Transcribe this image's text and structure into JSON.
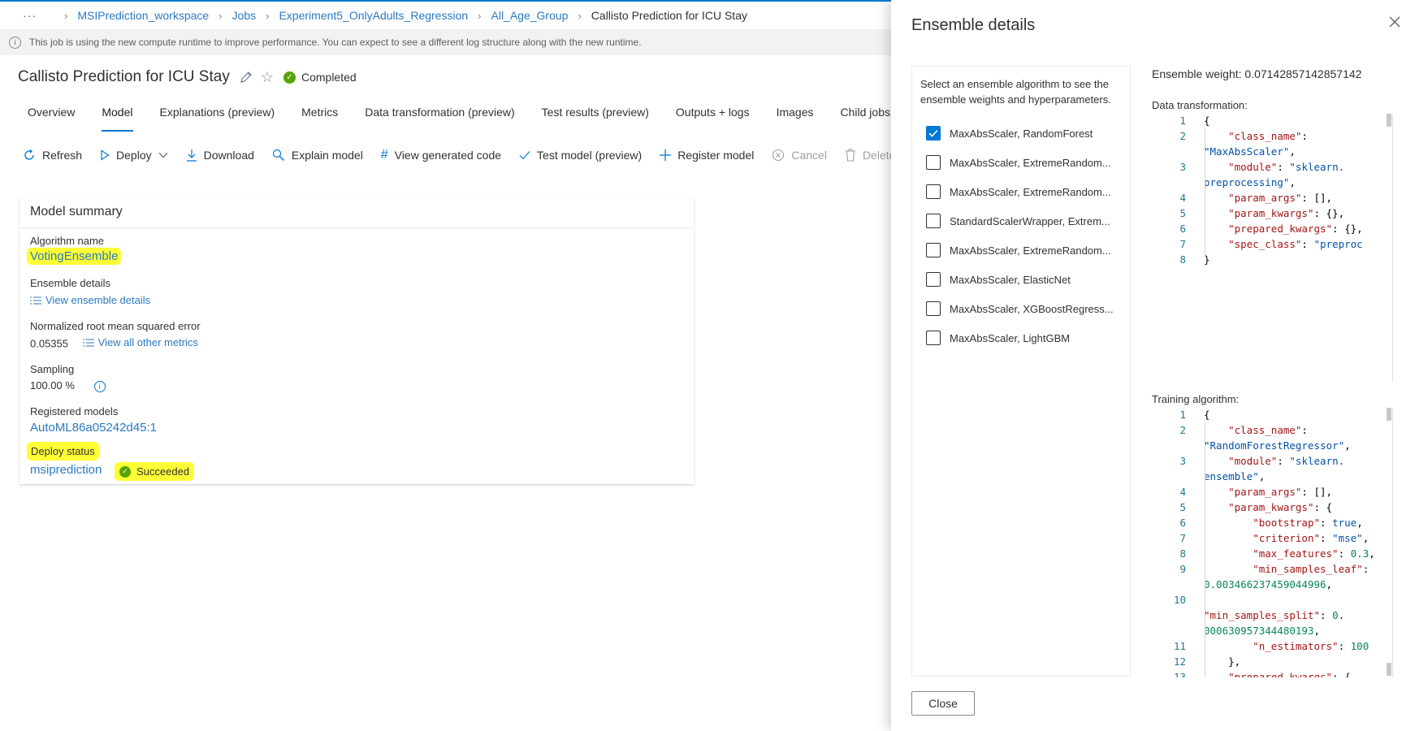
{
  "breadcrumb": {
    "more": "···",
    "items": [
      "MSIPrediction_workspace",
      "Jobs",
      "Experiment5_OnlyAdults_Regression",
      "All_Age_Group"
    ],
    "current": "Callisto Prediction for ICU Stay"
  },
  "info_bar": "This job is using the new compute runtime to improve performance. You can expect to see a different log structure along with the new runtime.",
  "job": {
    "title": "Callisto Prediction for ICU Stay",
    "status": "Completed"
  },
  "tabs": [
    "Overview",
    "Model",
    "Explanations (preview)",
    "Metrics",
    "Data transformation (preview)",
    "Test results (preview)",
    "Outputs + logs",
    "Images",
    "Child jobs"
  ],
  "active_tab": "Model",
  "toolbar": {
    "refresh": "Refresh",
    "deploy": "Deploy",
    "download": "Download",
    "explain": "Explain model",
    "view_code": "View generated code",
    "test_model": "Test model (preview)",
    "register": "Register model",
    "cancel": "Cancel",
    "delete": "Delete"
  },
  "summary": {
    "title": "Model summary",
    "algorithm_label": "Algorithm name",
    "algorithm_value": "VotingEnsemble",
    "ensemble_label": "Ensemble details",
    "ensemble_link": "View ensemble details",
    "nrmse_label": "Normalized root mean squared error",
    "nrmse_value": "0.05355",
    "metrics_link": "View all other metrics",
    "sampling_label": "Sampling",
    "sampling_value": "100.00 %",
    "registered_label": "Registered models",
    "registered_value": "AutoML86a05242d45:1",
    "deploy_label": "Deploy status",
    "deploy_value": "msiprediction",
    "deploy_status": "Succeeded"
  },
  "panel": {
    "title": "Ensemble details",
    "prompt": "Select an ensemble algorithm to see the ensemble weights and hyperparameters.",
    "algorithms": [
      {
        "label": "MaxAbsScaler, RandomForest",
        "checked": true
      },
      {
        "label": "MaxAbsScaler, ExtremeRandom...",
        "checked": false
      },
      {
        "label": "MaxAbsScaler, ExtremeRandom...",
        "checked": false
      },
      {
        "label": "StandardScalerWrapper, Extrem...",
        "checked": false
      },
      {
        "label": "MaxAbsScaler, ExtremeRandom...",
        "checked": false
      },
      {
        "label": "MaxAbsScaler, ElasticNet",
        "checked": false
      },
      {
        "label": "MaxAbsScaler, XGBoostRegress...",
        "checked": false
      },
      {
        "label": "MaxAbsScaler, LightGBM",
        "checked": false
      }
    ],
    "weight": "Ensemble weight: 0.07142857142857142",
    "data_transformation_label": "Data transformation:",
    "data_transformation_code": [
      {
        "n": "1",
        "t": "{"
      },
      {
        "n": "2",
        "t": "    \"class_name\":"
      },
      {
        "n": "",
        "t": "\"MaxAbsScaler\","
      },
      {
        "n": "3",
        "t": "    \"module\": \"sklearn."
      },
      {
        "n": "",
        "t": "preprocessing\","
      },
      {
        "n": "4",
        "t": "    \"param_args\": [],"
      },
      {
        "n": "5",
        "t": "    \"param_kwargs\": {},"
      },
      {
        "n": "6",
        "t": "    \"prepared_kwargs\": {},"
      },
      {
        "n": "7",
        "t": "    \"spec_class\": \"preproc"
      },
      {
        "n": "8",
        "t": "}"
      }
    ],
    "training_algorithm_label": "Training algorithm:",
    "training_algorithm_code": [
      {
        "n": "1",
        "t": "{"
      },
      {
        "n": "2",
        "t": "    \"class_name\":"
      },
      {
        "n": "",
        "t": "\"RandomForestRegressor\","
      },
      {
        "n": "3",
        "t": "    \"module\": \"sklearn."
      },
      {
        "n": "",
        "t": "ensemble\","
      },
      {
        "n": "4",
        "t": "    \"param_args\": [],"
      },
      {
        "n": "5",
        "t": "    \"param_kwargs\": {"
      },
      {
        "n": "6",
        "t": "        \"bootstrap\": true,"
      },
      {
        "n": "7",
        "t": "        \"criterion\": \"mse\","
      },
      {
        "n": "8",
        "t": "        \"max_features\": 0.3,"
      },
      {
        "n": "9",
        "t": "        \"min_samples_leaf\":"
      },
      {
        "n": "",
        "t": "0.003466237459044996,"
      },
      {
        "n": "10",
        "t": ""
      },
      {
        "n": "",
        "t": "\"min_samples_split\": 0."
      },
      {
        "n": "",
        "t": "000630957344480193,"
      },
      {
        "n": "11",
        "t": "        \"n_estimators\": 100"
      },
      {
        "n": "12",
        "t": "    },"
      },
      {
        "n": "13",
        "t": "    \"prepared_kwargs\": {"
      }
    ],
    "close_button": "Close"
  }
}
